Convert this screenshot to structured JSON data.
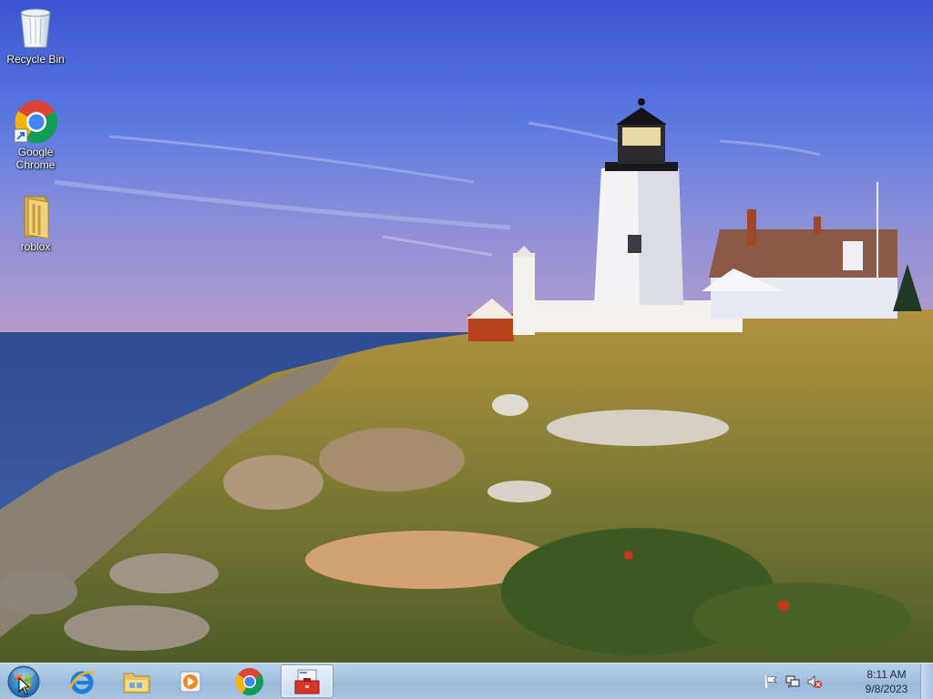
{
  "desktop": {
    "icons": [
      {
        "label": "Recycle Bin",
        "icon": "recycle-bin-icon"
      },
      {
        "label": "Google\nChrome",
        "line1": "Google",
        "line2": "Chrome",
        "icon": "chrome-icon"
      },
      {
        "label": "roblox",
        "icon": "folder-icon"
      }
    ]
  },
  "taskbar": {
    "start": {
      "icon": "windows-start-orb-icon"
    },
    "pinned": [
      {
        "name": "Internet Explorer",
        "icon": "internet-explorer-icon"
      },
      {
        "name": "Windows Explorer",
        "icon": "file-explorer-icon"
      },
      {
        "name": "Windows Media Player",
        "icon": "media-player-icon"
      },
      {
        "name": "Google Chrome",
        "icon": "chrome-icon"
      },
      {
        "name": "Toolbox application",
        "icon": "toolbox-icon",
        "active": true
      }
    ],
    "tray": {
      "icons": [
        "action-center-flag-icon",
        "network-icon",
        "volume-muted-icon"
      ],
      "time": "8:11 AM",
      "date": "9/8/2023"
    }
  },
  "colors": {
    "sky_top": "#3f5fd6",
    "sky_bottom": "#9a8fd0",
    "sea": "#2a4a8c",
    "grass": "#9a8a3c",
    "taskbar": "#a9c4e3"
  }
}
